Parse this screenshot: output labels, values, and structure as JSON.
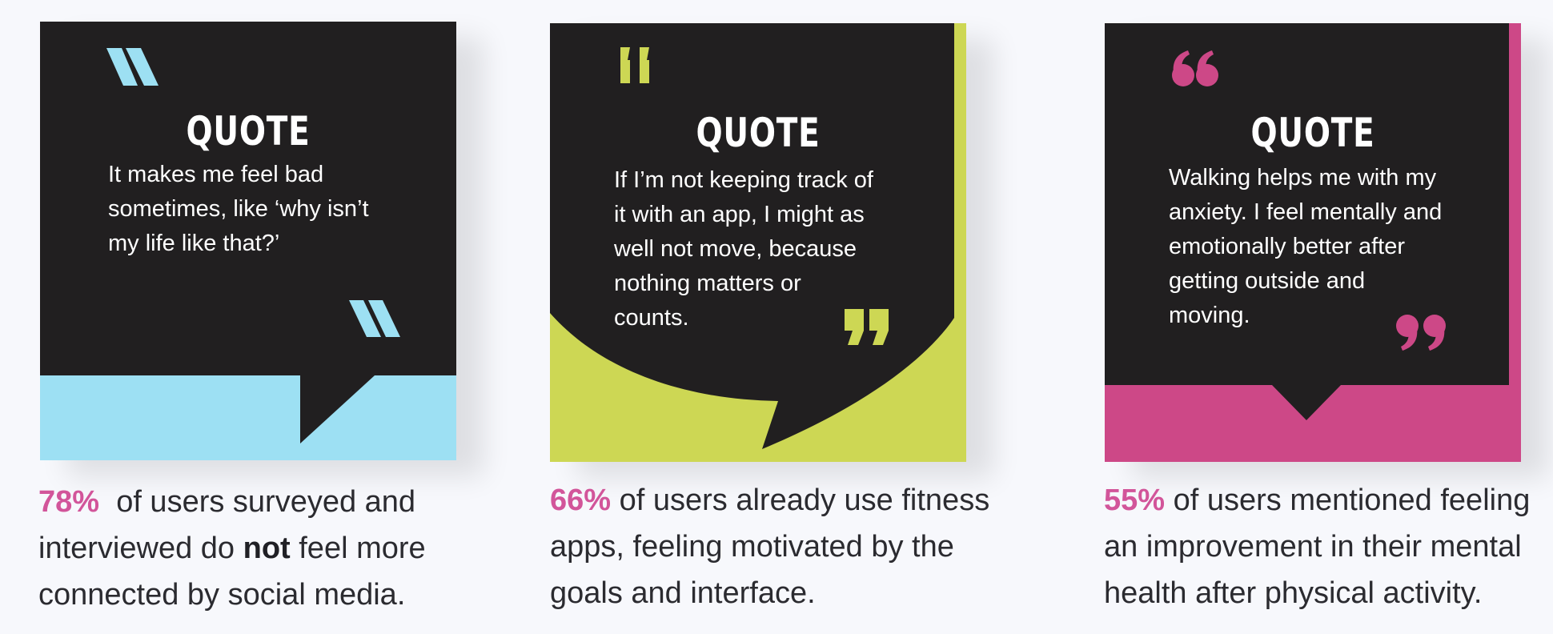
{
  "colors": {
    "dark": "#211f20",
    "blue": "#9de0f3",
    "lime": "#cdd754",
    "magenta": "#cd4887",
    "stat_pct": "#d2559a"
  },
  "cards": [
    {
      "title": "QUOTE",
      "quote_lines": [
        "It makes me feel bad",
        "sometimes, like ‘why isn’t",
        "my life like that?’"
      ],
      "accent": "blue"
    },
    {
      "title": "QUOTE",
      "quote_lines": [
        "If I’m not keeping track of",
        "it with an app, I might as",
        "well not move, because",
        "nothing matters or",
        "counts."
      ],
      "accent": "lime"
    },
    {
      "title": "QUOTE",
      "quote_lines": [
        "Walking helps me with my",
        "anxiety. I feel mentally and",
        "emotionally better after",
        "getting outside and",
        "moving."
      ],
      "accent": "magenta"
    }
  ],
  "stats": [
    {
      "percent": "78%",
      "line1_rest": "of users surveyed and",
      "line2_pre": "interviewed do",
      "line2_bold": "not",
      "line2_post": "feel more",
      "line3": "connected by social media."
    },
    {
      "percent": "66%",
      "line1_rest": "of users already use fitness",
      "line2": "apps, feeling motivated by the",
      "line3": "goals and interface."
    },
    {
      "percent": "55%",
      "line1_rest": "of users mentioned feeling",
      "line2": "an improvement in their mental",
      "line3": "health after physical activity."
    }
  ]
}
